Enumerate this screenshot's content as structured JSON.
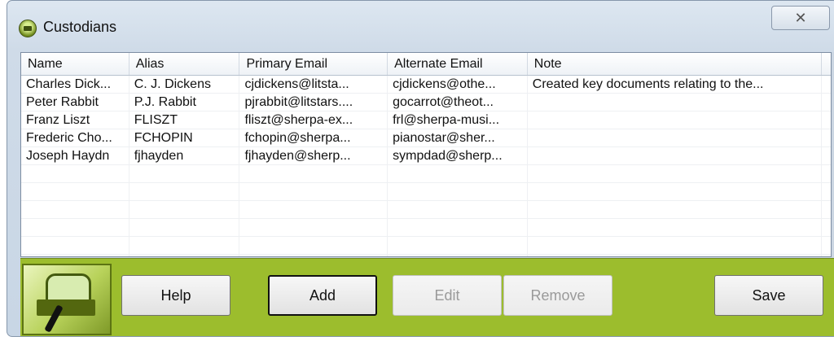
{
  "window": {
    "title": "Custodians",
    "close_label": "✕"
  },
  "table": {
    "columns": [
      "Name",
      "Alias",
      "Primary Email",
      "Alternate Email",
      "Note"
    ],
    "rows": [
      [
        "Charles Dick...",
        "C. J. Dickens",
        "cjdickens@litsta...",
        "cjdickens@othe...",
        "Created key documents relating to the..."
      ],
      [
        "Peter Rabbit",
        "P.J. Rabbit",
        "pjrabbit@litstars....",
        "gocarrot@theot...",
        ""
      ],
      [
        "Franz Liszt",
        "FLISZT",
        "fliszt@sherpa-ex...",
        "frl@sherpa-musi...",
        ""
      ],
      [
        "Frederic Cho...",
        "FCHOPIN",
        "fchopin@sherpa...",
        "pianostar@sher...",
        ""
      ],
      [
        "Joseph Haydn",
        "fjhayden",
        "fjhayden@sherp...",
        "sympdad@sherp...",
        ""
      ],
      [
        "",
        "",
        "",
        "",
        ""
      ],
      [
        "",
        "",
        "",
        "",
        ""
      ],
      [
        "",
        "",
        "",
        "",
        ""
      ],
      [
        "",
        "",
        "",
        "",
        ""
      ],
      [
        "",
        "",
        "",
        "",
        ""
      ],
      [
        "",
        "",
        "",
        "",
        ""
      ]
    ]
  },
  "toolbar": {
    "help_label": "Help",
    "add_label": "Add",
    "edit_label": "Edit",
    "remove_label": "Remove",
    "save_label": "Save"
  },
  "icons": {
    "app": "custodians-app-icon",
    "logo": "custodian-logo-icon"
  },
  "colors": {
    "toolbar": "#9cbd2d",
    "window_frame": "#c8d6e5",
    "disabled_text": "#9a9a9a"
  }
}
